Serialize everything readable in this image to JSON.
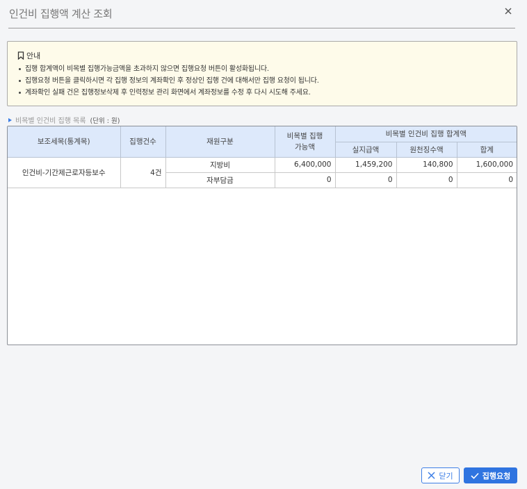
{
  "dialog": {
    "title": "인건비 집행액 계산 조회"
  },
  "notice": {
    "heading": "안내",
    "items": [
      "집행 합계액이 비목별 집행가능금액을 초과하지 않으면 집행요청 버튼이 활성화됩니다.",
      "집행요청 버튼을 클릭하시면 각 집행 정보의 계좌확인 후 정상인 집행 건에 대해서만 집행 요청이 됩니다.",
      "계좌확인 실패 건은 집행정보삭제 후 인력정보 관리 화면에서 계좌정보를 수정 후 다시 시도해 주세요."
    ]
  },
  "section": {
    "label": "비목별 인건비 집행 목록",
    "unit": "(단위 : 원)"
  },
  "table": {
    "headers": {
      "sub_item": "보조세목(통계목)",
      "count": "집행건수",
      "fund_type": "재원구분",
      "available": "비목별 집행가능액",
      "total_group": "비목별 인건비 집행 합계액",
      "actual_pay": "실지급액",
      "withholding": "원천징수액",
      "sum": "합계"
    },
    "group": {
      "sub_item": "인건비-기간제근로자등보수",
      "count": "4건"
    },
    "rows": [
      {
        "fund_type": "지방비",
        "available": "6,400,000",
        "actual_pay": "1,459,200",
        "withholding": "140,800",
        "sum": "1,600,000"
      },
      {
        "fund_type": "자부담금",
        "available": "0",
        "actual_pay": "0",
        "withholding": "0",
        "sum": "0"
      }
    ]
  },
  "buttons": {
    "close": "닫기",
    "execute": "집행요청"
  },
  "colors": {
    "accent": "#2f74e0",
    "notice_bg": "#fefbea",
    "header_bg": "#dde9fb"
  }
}
